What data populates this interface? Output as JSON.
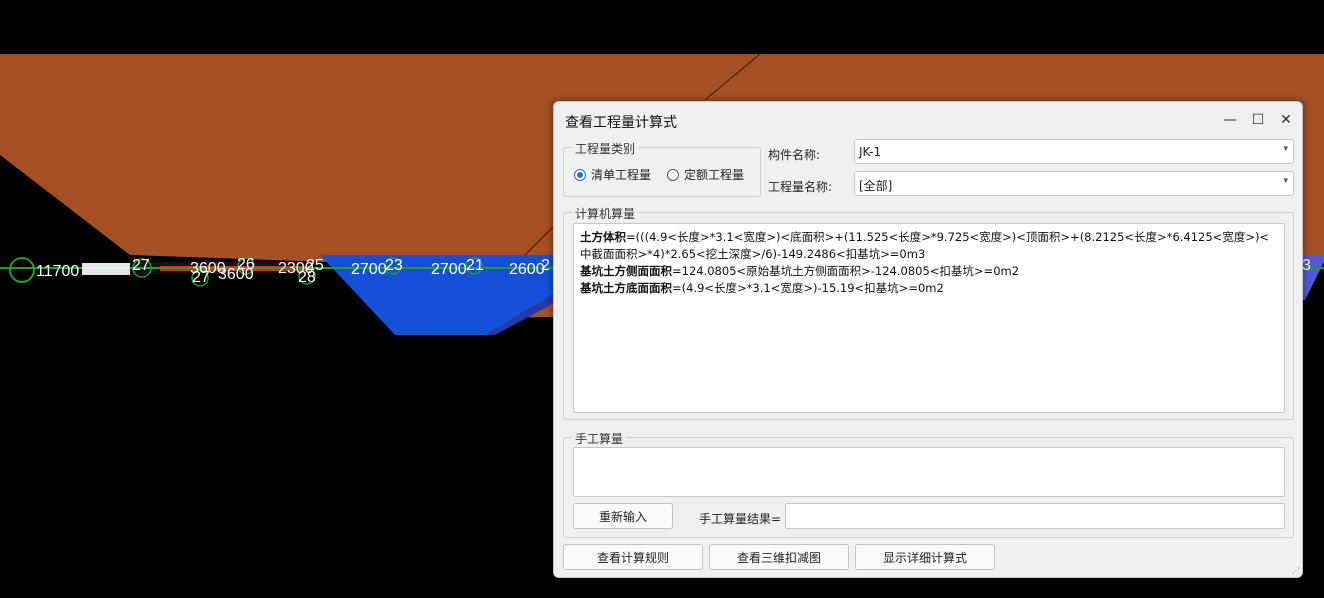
{
  "scene": {
    "dimensions": [
      "27",
      "3600",
      "26",
      "2300",
      "25",
      "27",
      "3600",
      "28",
      "2700",
      "23",
      "2700",
      "21",
      "2600",
      "2",
      "3",
      "11700"
    ],
    "colors": {
      "soil": "#a64f24",
      "pit": "#1550d8",
      "pit_side": "#3a3fb8",
      "background": "#000000"
    }
  },
  "dialog": {
    "title": "查看工程量计算式",
    "controls": {
      "minimize": "—",
      "maximize": "☐",
      "close": "✕"
    },
    "category": {
      "legend": "工程量类别",
      "options": [
        {
          "label": "清单工程量",
          "selected": true
        },
        {
          "label": "定额工程量",
          "selected": false
        }
      ]
    },
    "component_name": {
      "label": "构件名称:",
      "value": "JK-1"
    },
    "quantity_name": {
      "label": "工程量名称:",
      "value": "[全部]"
    },
    "computer": {
      "legend": "计算机算量",
      "lines": [
        {
          "name": "土方体积",
          "expr": "=(((4.9<长度>*3.1<宽度>)<底面积>+(11.525<长度>*9.725<宽度>)<顶面积>+(8.2125<长度>*6.4125<宽度>)<中截面面积>*4)*2.65<挖土深度>/6)-149.2486<扣基坑>=0m3"
        },
        {
          "name": "基坑土方侧面面积",
          "expr": "=124.0805<原始基坑土方侧面面积>-124.0805<扣基坑>=0m2"
        },
        {
          "name": "基坑土方底面面积",
          "expr": "=(4.9<长度>*3.1<宽度>)-15.19<扣基坑>=0m2"
        }
      ]
    },
    "manual": {
      "legend": "手工算量",
      "reenter_button": "重新输入",
      "result_label": "手工算量结果=",
      "result_value": ""
    },
    "buttons": {
      "rules": "查看计算规则",
      "view3d": "查看三维扣减图",
      "detail": "显示详细计算式"
    }
  }
}
